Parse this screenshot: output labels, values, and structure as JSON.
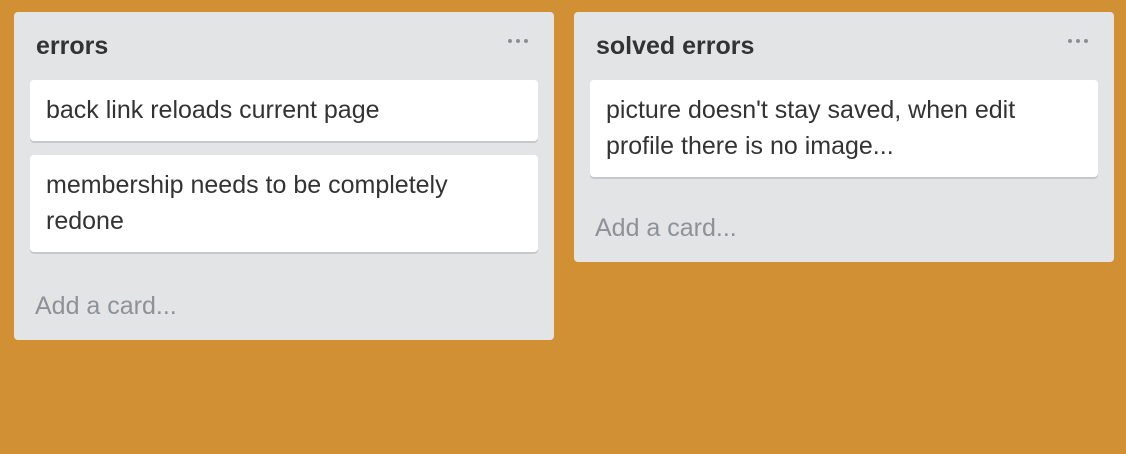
{
  "lists": [
    {
      "title": "errors",
      "menu_icon": "ellipsis-icon",
      "cards": [
        "back link reloads current page",
        "membership needs to be completely redone"
      ],
      "add_card_label": "Add a card..."
    },
    {
      "title": "solved errors",
      "menu_icon": "ellipsis-icon",
      "cards": [
        "picture doesn't stay saved, when edit profile there is no image..."
      ],
      "add_card_label": "Add a card..."
    }
  ],
  "colors": {
    "board_background": "#D29034",
    "list_background": "#E2E4E6",
    "card_background": "#FFFFFF",
    "text": "#333333",
    "muted_text": "#8C9296"
  }
}
